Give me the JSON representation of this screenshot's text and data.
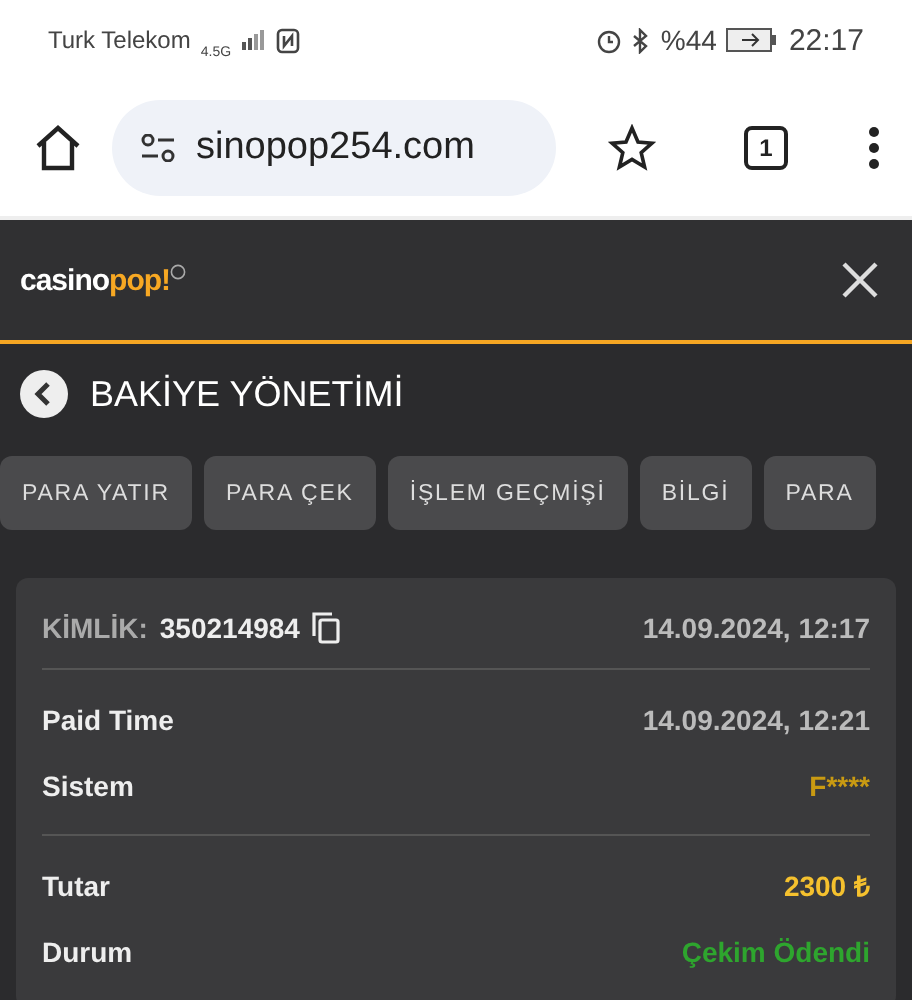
{
  "status_bar": {
    "carrier": "Turk Telekom",
    "network": "4.5G",
    "battery": "%44",
    "time": "22:17"
  },
  "browser": {
    "url": "sinopop254.com",
    "tab_count": "1"
  },
  "header": {
    "logo_text": "casino",
    "logo_accent": "pop!"
  },
  "page_title": "BAKİYE YÖNETİMİ",
  "tabs": [
    {
      "label": "PARA YATIR",
      "selected": false
    },
    {
      "label": "PARA ÇEK",
      "selected": false
    },
    {
      "label": "İŞLEM GEÇMİŞİ",
      "selected": false
    },
    {
      "label": "BİLGİ",
      "selected": false
    },
    {
      "label": "PARA",
      "selected": false
    }
  ],
  "transaction": {
    "id_label": "KİMLİK:",
    "id": "350214984",
    "date": "14.09.2024, 12:17",
    "sections": [
      [
        {
          "label": "Paid Time",
          "value": "14.09.2024, 12:21"
        },
        {
          "label": "Sistem",
          "value": "F****",
          "color": "#c99a12"
        }
      ],
      [
        {
          "label": "Tutar",
          "value": "2300 ₺",
          "color": "#f5c12e"
        },
        {
          "label": "Durum",
          "value": "Çekim Ödendi",
          "color": "#2ea52e"
        }
      ]
    ]
  }
}
